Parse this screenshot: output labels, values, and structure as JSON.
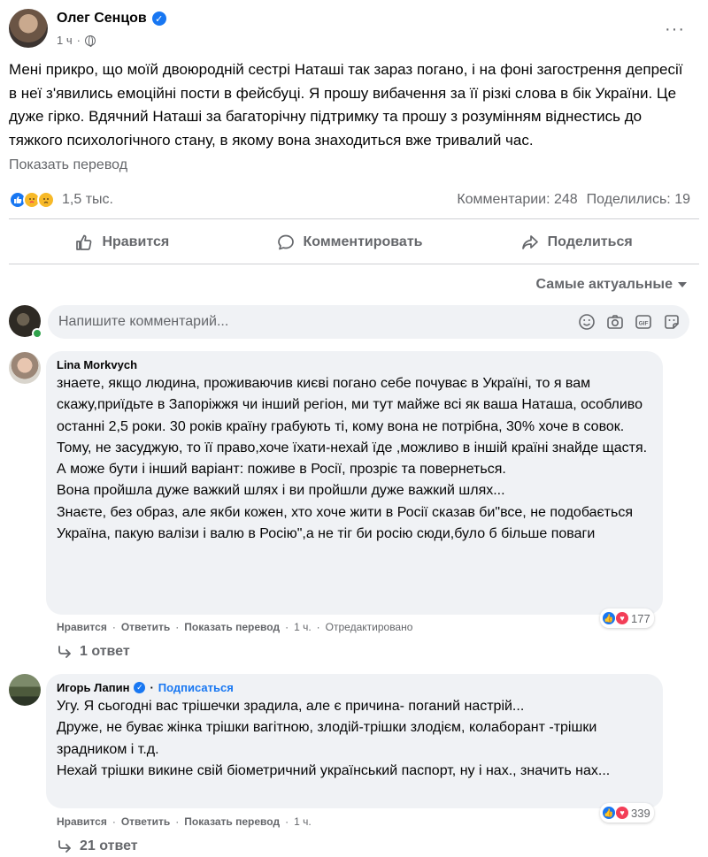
{
  "post": {
    "author": "Олег Сенцов",
    "time": "1 ч",
    "more": "···",
    "text": "Мені прикро, що моїй двоюродній сестрі Наташі так зараз погано, і на фоні загострення депресії в неї з'явились емоційні пости в фейсбуці. Я прошу вибачення за її різкі слова в бік України. Це дуже гірко. Вдячний Наташі за багаторічну підтримку та прошу з розумінням віднестись до тяжкого психологічного стану, в якому вона знаходиться вже тривалий час.",
    "see_translation": "Показать перевод",
    "reactions_count": "1,5 тыс.",
    "comments_count": "Комментарии: 248",
    "shares_count": "Поделились: 19"
  },
  "actions": {
    "like": "Нравится",
    "comment": "Комментировать",
    "share": "Поделиться"
  },
  "sort": {
    "label": "Самые актуальные"
  },
  "composer": {
    "placeholder": "Напишите комментарий..."
  },
  "comments": [
    {
      "author": "Lina Morkvych",
      "paragraphs": [
        "знаете, якщо людина, проживаючив києві погано себе почуває в Україні, то я вам скажу,приїдьте в Запоріжжя чи інший регіон, ми тут майже всі як ваша Наташа, особливо останні 2,5 роки. 30 років країну грабують ті, кому вона не потрібна, 30% хоче в совок.",
        "Тому, не засуджую, то її право,хоче їхати-нехай їде ,можливо в іншій країні знайде щастя. А може бути і інший варіант: поживе в Росії, прозріє та повернеться.",
        "Вона пройшла дуже важкий шлях і ви пройшли дуже важкий шлях...",
        "Знаєте, без образ, але якби кожен, хто хоче жити в Росії сказав би\"все, не подобається Україна, пакую валізи і валю в Росію\",а не тіг би росію сюди,було б більше поваги"
      ],
      "like": "Нравится",
      "reply": "Ответить",
      "translate": "Показать перевод",
      "time": "1 ч.",
      "edited": "Отредактировано",
      "reactions": "177",
      "replies": "1 ответ"
    },
    {
      "author": "Игорь Лапин",
      "follow": "Подписаться",
      "paragraphs": [
        "Угу. Я сьогодні вас трішечки зрадила, але є причина- поганий настрій...",
        "Друже, не буває жінка трішки вагітною, злодій-трішки злодієм, колаборант -трішки зрадником і т.д.",
        "Нехай трішки викине свій біометричний український паспорт, ну і нах., значить нах..."
      ],
      "like": "Нравится",
      "reply": "Ответить",
      "translate": "Показать перевод",
      "time": "1 ч.",
      "reactions": "339",
      "replies": "21 ответ"
    }
  ],
  "colors": {
    "accent": "#1877f2",
    "secondary_text": "#65676b",
    "bubble": "#f0f2f5",
    "love": "#f33e58",
    "online": "#31a24c"
  }
}
